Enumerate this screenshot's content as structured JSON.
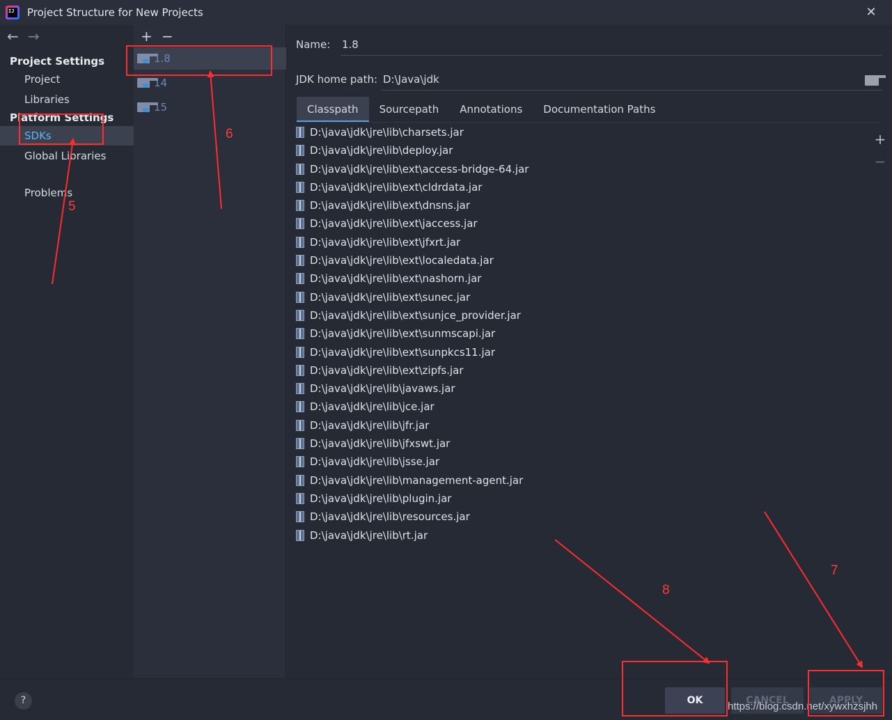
{
  "window": {
    "title": "Project Structure for New Projects"
  },
  "nav": {
    "project_settings_heading": "Project Settings",
    "platform_settings_heading": "Platform Settings",
    "items": {
      "project": "Project",
      "libraries": "Libraries",
      "sdks": "SDKs",
      "global_libraries": "Global Libraries",
      "problems": "Problems"
    },
    "selected": "SDKs"
  },
  "sdk_list": {
    "add": "+",
    "remove": "−",
    "items": [
      "1.8",
      "14",
      "15"
    ],
    "selected": "1.8"
  },
  "detail": {
    "name_label": "Name:",
    "name_value": "1.8",
    "jdk_home_label": "JDK home path:",
    "jdk_home_value": "D:\\Java\\jdk",
    "tabs": [
      "Classpath",
      "Sourcepath",
      "Annotations",
      "Documentation Paths"
    ],
    "active_tab": "Classpath",
    "classpath": [
      "D:\\java\\jdk\\jre\\lib\\charsets.jar",
      "D:\\java\\jdk\\jre\\lib\\deploy.jar",
      "D:\\java\\jdk\\jre\\lib\\ext\\access-bridge-64.jar",
      "D:\\java\\jdk\\jre\\lib\\ext\\cldrdata.jar",
      "D:\\java\\jdk\\jre\\lib\\ext\\dnsns.jar",
      "D:\\java\\jdk\\jre\\lib\\ext\\jaccess.jar",
      "D:\\java\\jdk\\jre\\lib\\ext\\jfxrt.jar",
      "D:\\java\\jdk\\jre\\lib\\ext\\localedata.jar",
      "D:\\java\\jdk\\jre\\lib\\ext\\nashorn.jar",
      "D:\\java\\jdk\\jre\\lib\\ext\\sunec.jar",
      "D:\\java\\jdk\\jre\\lib\\ext\\sunjce_provider.jar",
      "D:\\java\\jdk\\jre\\lib\\ext\\sunmscapi.jar",
      "D:\\java\\jdk\\jre\\lib\\ext\\sunpkcs11.jar",
      "D:\\java\\jdk\\jre\\lib\\ext\\zipfs.jar",
      "D:\\java\\jdk\\jre\\lib\\javaws.jar",
      "D:\\java\\jdk\\jre\\lib\\jce.jar",
      "D:\\java\\jdk\\jre\\lib\\jfr.jar",
      "D:\\java\\jdk\\jre\\lib\\jfxswt.jar",
      "D:\\java\\jdk\\jre\\lib\\jsse.jar",
      "D:\\java\\jdk\\jre\\lib\\management-agent.jar",
      "D:\\java\\jdk\\jre\\lib\\plugin.jar",
      "D:\\java\\jdk\\jre\\lib\\resources.jar",
      "D:\\java\\jdk\\jre\\lib\\rt.jar"
    ]
  },
  "buttons": {
    "help": "?",
    "ok": "OK",
    "cancel": "CANCEL",
    "apply": "APPLY"
  },
  "watermark": "https://blog.csdn.net/xywxhzsjhh",
  "annotations": {
    "labels": [
      "5",
      "6",
      "7",
      "8"
    ],
    "color": "#ff2d2d"
  },
  "colors": {
    "background": "#262a34",
    "panel": "#2b2f3b",
    "selection": "#3c4150",
    "accent": "#5fb3f0"
  }
}
